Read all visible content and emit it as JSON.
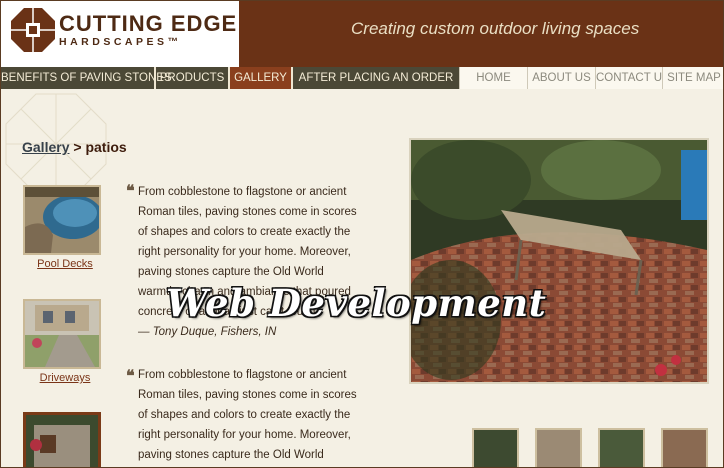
{
  "header": {
    "brand_name": "CUTTING EDGE",
    "brand_sub": "HARDSCAPES™",
    "tagline": "Creating custom outdoor living spaces"
  },
  "nav": {
    "main": [
      "BENEFITS OF PAVING STONES",
      "PRODUCTS",
      "GALLERY",
      "AFTER PLACING AN ORDER"
    ],
    "active": "GALLERY",
    "secondary": [
      "HOME",
      "ABOUT US",
      "CONTACT US",
      "SITE MAP"
    ]
  },
  "breadcrumb": {
    "link": "Gallery",
    "separator": " > ",
    "current": "patios"
  },
  "thumbnails": [
    {
      "label": "Pool Decks"
    },
    {
      "label": "Driveways"
    }
  ],
  "testimonials": [
    {
      "lines": [
        "From cobblestone to flagstone or ancient",
        "Roman tiles, paving stones come in scores",
        "of shapes and colors to create exactly the",
        "right personality for your home. Moreover,",
        "paving stones capture the Old World",
        "warmth, charm and ambiance that poured",
        "concrete or asphalt just can't touch."
      ],
      "attribution": "— Tony Duque, Fishers, IN"
    },
    {
      "lines": [
        "From cobblestone to flagstone or ancient",
        "Roman tiles, paving stones come in scores",
        "of shapes and colors to create exactly the",
        "right personality for your home. Moreover,",
        "paving stones capture the Old World"
      ]
    }
  ],
  "overlay_text": "Web Development",
  "colors": {
    "brand_brown": "#6a3216",
    "nav_dark": "#4b4836",
    "nav_active": "#8a3f1d",
    "link": "#7a3417"
  }
}
